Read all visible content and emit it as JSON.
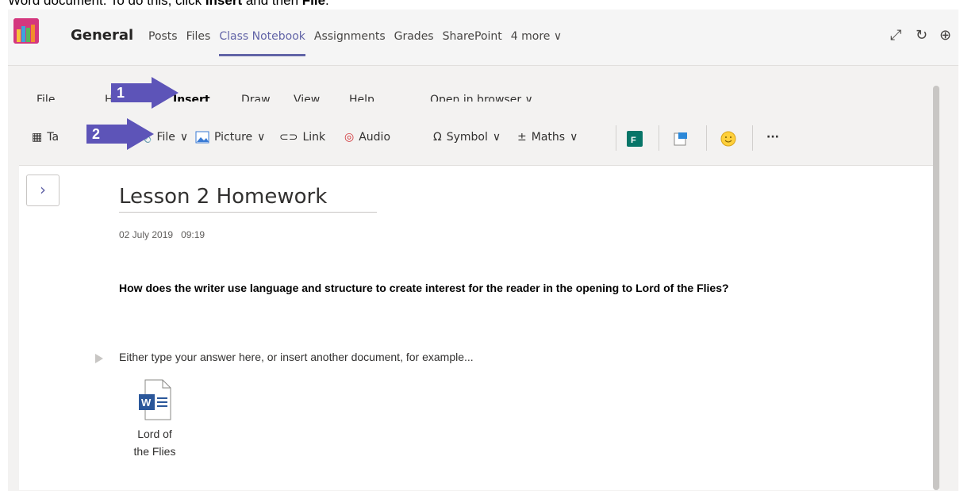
{
  "instruction": {
    "text": "Word document. To do this, click ",
    "bold1": "Insert",
    "mid": " and then ",
    "bold2": "File",
    "end": "."
  },
  "header": {
    "team_name": "General",
    "tabs": [
      "Posts",
      "Files",
      "Class Notebook",
      "Assignments",
      "Grades",
      "SharePoint",
      "4 more"
    ],
    "active_tab": "Class Notebook",
    "more_chevron": "∨",
    "icons": [
      "expand-icon",
      "refresh-icon",
      "globe-icon"
    ]
  },
  "ribbon_tabs": {
    "file": "File",
    "home": "H",
    "insert": "Insert",
    "draw": "Draw",
    "view": "View",
    "help": "Help",
    "open_in_browser": "Open in browser"
  },
  "ribbon": {
    "table": "Ta",
    "file": "File",
    "picture": "Picture",
    "link": "Link",
    "audio": "Audio",
    "symbol": "Symbol",
    "maths": "Maths",
    "more": "···"
  },
  "annotations": {
    "step1": "1",
    "step2": "2"
  },
  "page": {
    "title": "Lesson 2 Homework",
    "date": "02 July 2019",
    "time": "09:19",
    "question": "How does the writer use language and structure to create interest for the reader in the opening to Lord of the Flies?",
    "answer_prompt": "Either type your answer here, or insert another document, for example...",
    "attachment": {
      "label_line1": "Lord of",
      "label_line2": "the Flies",
      "icon": "word-document-icon"
    }
  },
  "colors": {
    "accent": "#6264a7",
    "arrow": "#5d54b8",
    "word_blue": "#2b579a"
  }
}
